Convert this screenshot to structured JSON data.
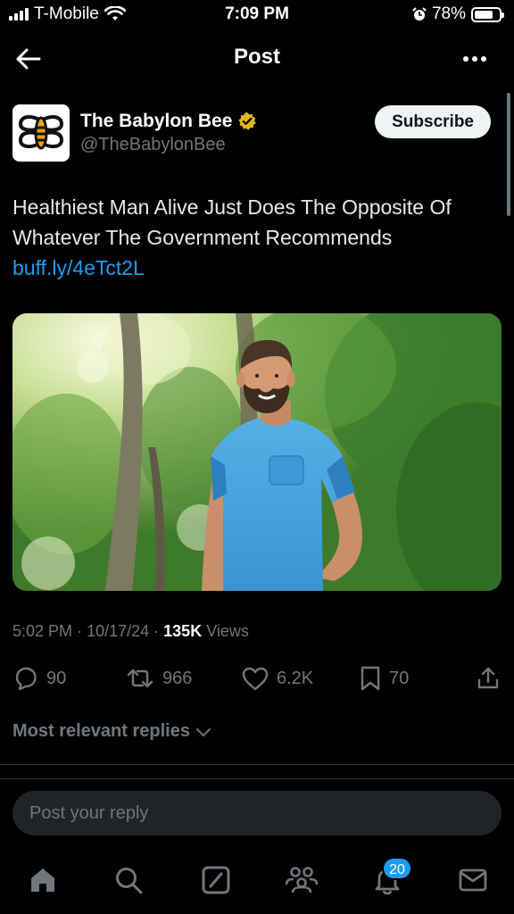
{
  "status_bar": {
    "carrier": "T-Mobile",
    "time": "7:09 PM",
    "battery": "78%",
    "battery_level": 0.78
  },
  "header": {
    "title": "Post"
  },
  "post": {
    "author": {
      "name": "The Babylon Bee",
      "handle": "@TheBabylonBee",
      "verified": true
    },
    "subscribe_label": "Subscribe",
    "text": "Healthiest Man Alive Just Does The Opposite Of Whatever The Government Recommends ",
    "link": "buff.ly/4eTct2L",
    "meta": {
      "time": "5:02 PM",
      "date": "10/17/24",
      "views_count": "135K",
      "views_label": "Views"
    },
    "actions": {
      "replies": "90",
      "reposts": "966",
      "likes": "6.2K",
      "bookmarks": "70"
    }
  },
  "replies_filter": "Most relevant replies",
  "reply_box": {
    "placeholder": "Post your reply"
  },
  "tab_bar": {
    "notifications_badge": "20"
  },
  "colors": {
    "background": "#000000",
    "accent": "#1d9bf0",
    "verified_gold": "#e2b719",
    "muted_text": "#71767b"
  }
}
